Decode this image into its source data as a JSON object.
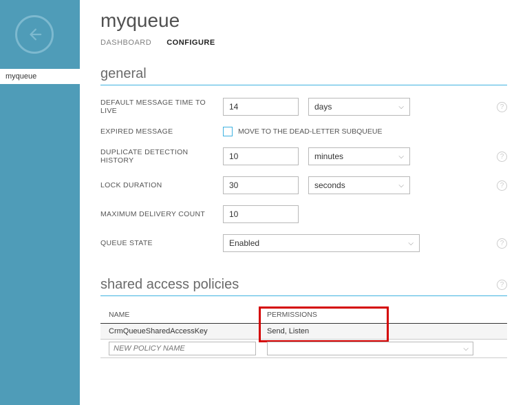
{
  "sidebar": {
    "item": "myqueue"
  },
  "page": {
    "title": "myqueue",
    "tabs": {
      "dashboard": "DASHBOARD",
      "configure": "CONFIGURE"
    }
  },
  "general": {
    "heading": "general",
    "labels": {
      "ttl": "DEFAULT MESSAGE TIME TO LIVE",
      "expired": "EXPIRED MESSAGE",
      "dedupe": "DUPLICATE DETECTION HISTORY",
      "lock": "LOCK DURATION",
      "maxdel": "MAXIMUM DELIVERY COUNT",
      "state": "QUEUE STATE"
    },
    "ttl_value": "14",
    "ttl_unit": "days",
    "expired_checkbox_label": "MOVE TO THE DEAD-LETTER SUBQUEUE",
    "dedupe_value": "10",
    "dedupe_unit": "minutes",
    "lock_value": "30",
    "lock_unit": "seconds",
    "maxdel_value": "10",
    "state_value": "Enabled"
  },
  "policies": {
    "heading": "shared access policies",
    "columns": {
      "name": "NAME",
      "permissions": "PERMISSIONS"
    },
    "row": {
      "name": "CrmQueueSharedAccessKey",
      "permissions": "Send, Listen"
    },
    "new_placeholder": "NEW POLICY NAME"
  }
}
